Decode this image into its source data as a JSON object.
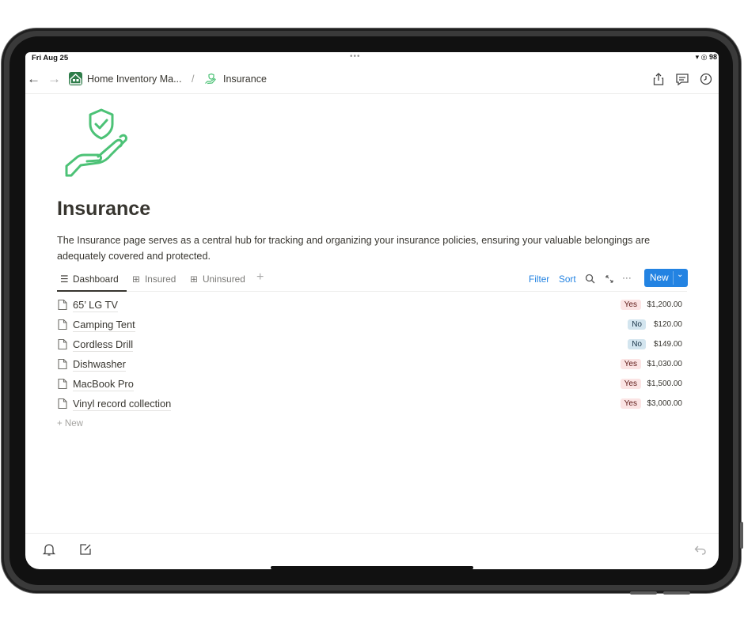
{
  "status": {
    "time": "Fri Aug 25",
    "dots": "•••",
    "battery": "98"
  },
  "topbar": {
    "workspace": "Home Inventory Ma...",
    "separator": "/",
    "page": "Insurance"
  },
  "page": {
    "title": "Insurance",
    "description": "The Insurance page serves as a central hub for tracking and organizing your insurance policies, ensuring your valuable belongings are adequately covered and protected."
  },
  "views": {
    "tabs": [
      {
        "label": "Dashboard",
        "icon": "list-icon"
      },
      {
        "label": "Insured",
        "icon": "gallery-icon"
      },
      {
        "label": "Uninsured",
        "icon": "gallery-icon"
      }
    ],
    "add": "+",
    "filter": "Filter",
    "sort": "Sort",
    "more": "···",
    "new_button": "New"
  },
  "items": [
    {
      "name": "65’ LG TV",
      "insured": "Yes",
      "value": "$1,200.00"
    },
    {
      "name": "Camping Tent",
      "insured": "No",
      "value": "$120.00"
    },
    {
      "name": "Cordless Drill",
      "insured": "No",
      "value": "$149.00"
    },
    {
      "name": "Dishwasher",
      "insured": "Yes",
      "value": "$1,030.00"
    },
    {
      "name": "MacBook Pro",
      "insured": "Yes",
      "value": "$1,500.00"
    },
    {
      "name": "Vinyl record collection",
      "insured": "Yes",
      "value": "$3,000.00"
    }
  ],
  "add_row": "+ New",
  "colors": {
    "accent": "#2383e2",
    "icon_green": "#4cc276",
    "yes_bg": "#fbe4e4",
    "no_bg": "#d3e5ef"
  }
}
